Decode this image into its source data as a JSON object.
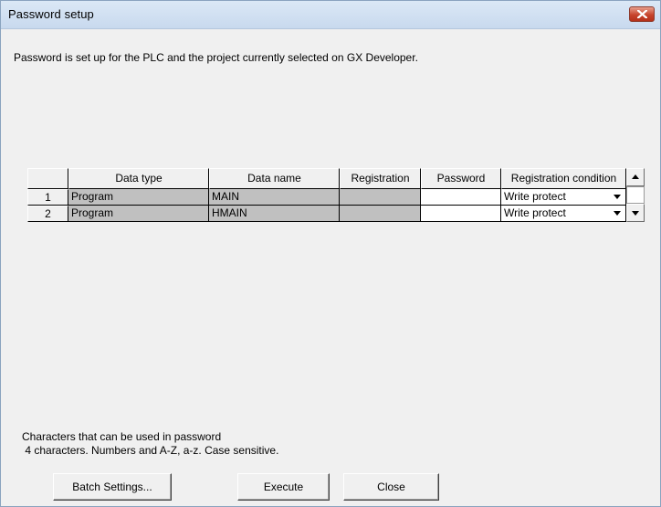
{
  "window": {
    "title": "Password setup"
  },
  "description": "Password is set up for the PLC and the project currently selected on GX Developer.",
  "table": {
    "headers": [
      "",
      "Data type",
      "Data name",
      "Registration",
      "Password",
      "Registration condition"
    ],
    "rows": [
      {
        "index": "1",
        "data_type": "Program",
        "data_name": "MAIN",
        "registration": "",
        "password": "",
        "registration_condition": "Write protect"
      },
      {
        "index": "2",
        "data_type": "Program",
        "data_name": "HMAIN",
        "registration": "",
        "password": "",
        "registration_condition": "Write protect"
      }
    ]
  },
  "hint": {
    "line1": "Characters that can be used in password",
    "line2": " 4 characters. Numbers and A-Z, a-z. Case sensitive."
  },
  "buttons": {
    "batch_settings": "Batch Settings...",
    "execute": "Execute",
    "close": "Close"
  },
  "icons": {
    "close": "close-x-icon",
    "dropdown": "dropdown-arrow-icon",
    "scroll_up": "scroll-up-arrow-icon",
    "scroll_down": "scroll-down-arrow-icon"
  },
  "colors": {
    "close_button": "#c7442c",
    "gray_cell": "#c0c0c0",
    "dialog_background": "#f0f0f0"
  }
}
